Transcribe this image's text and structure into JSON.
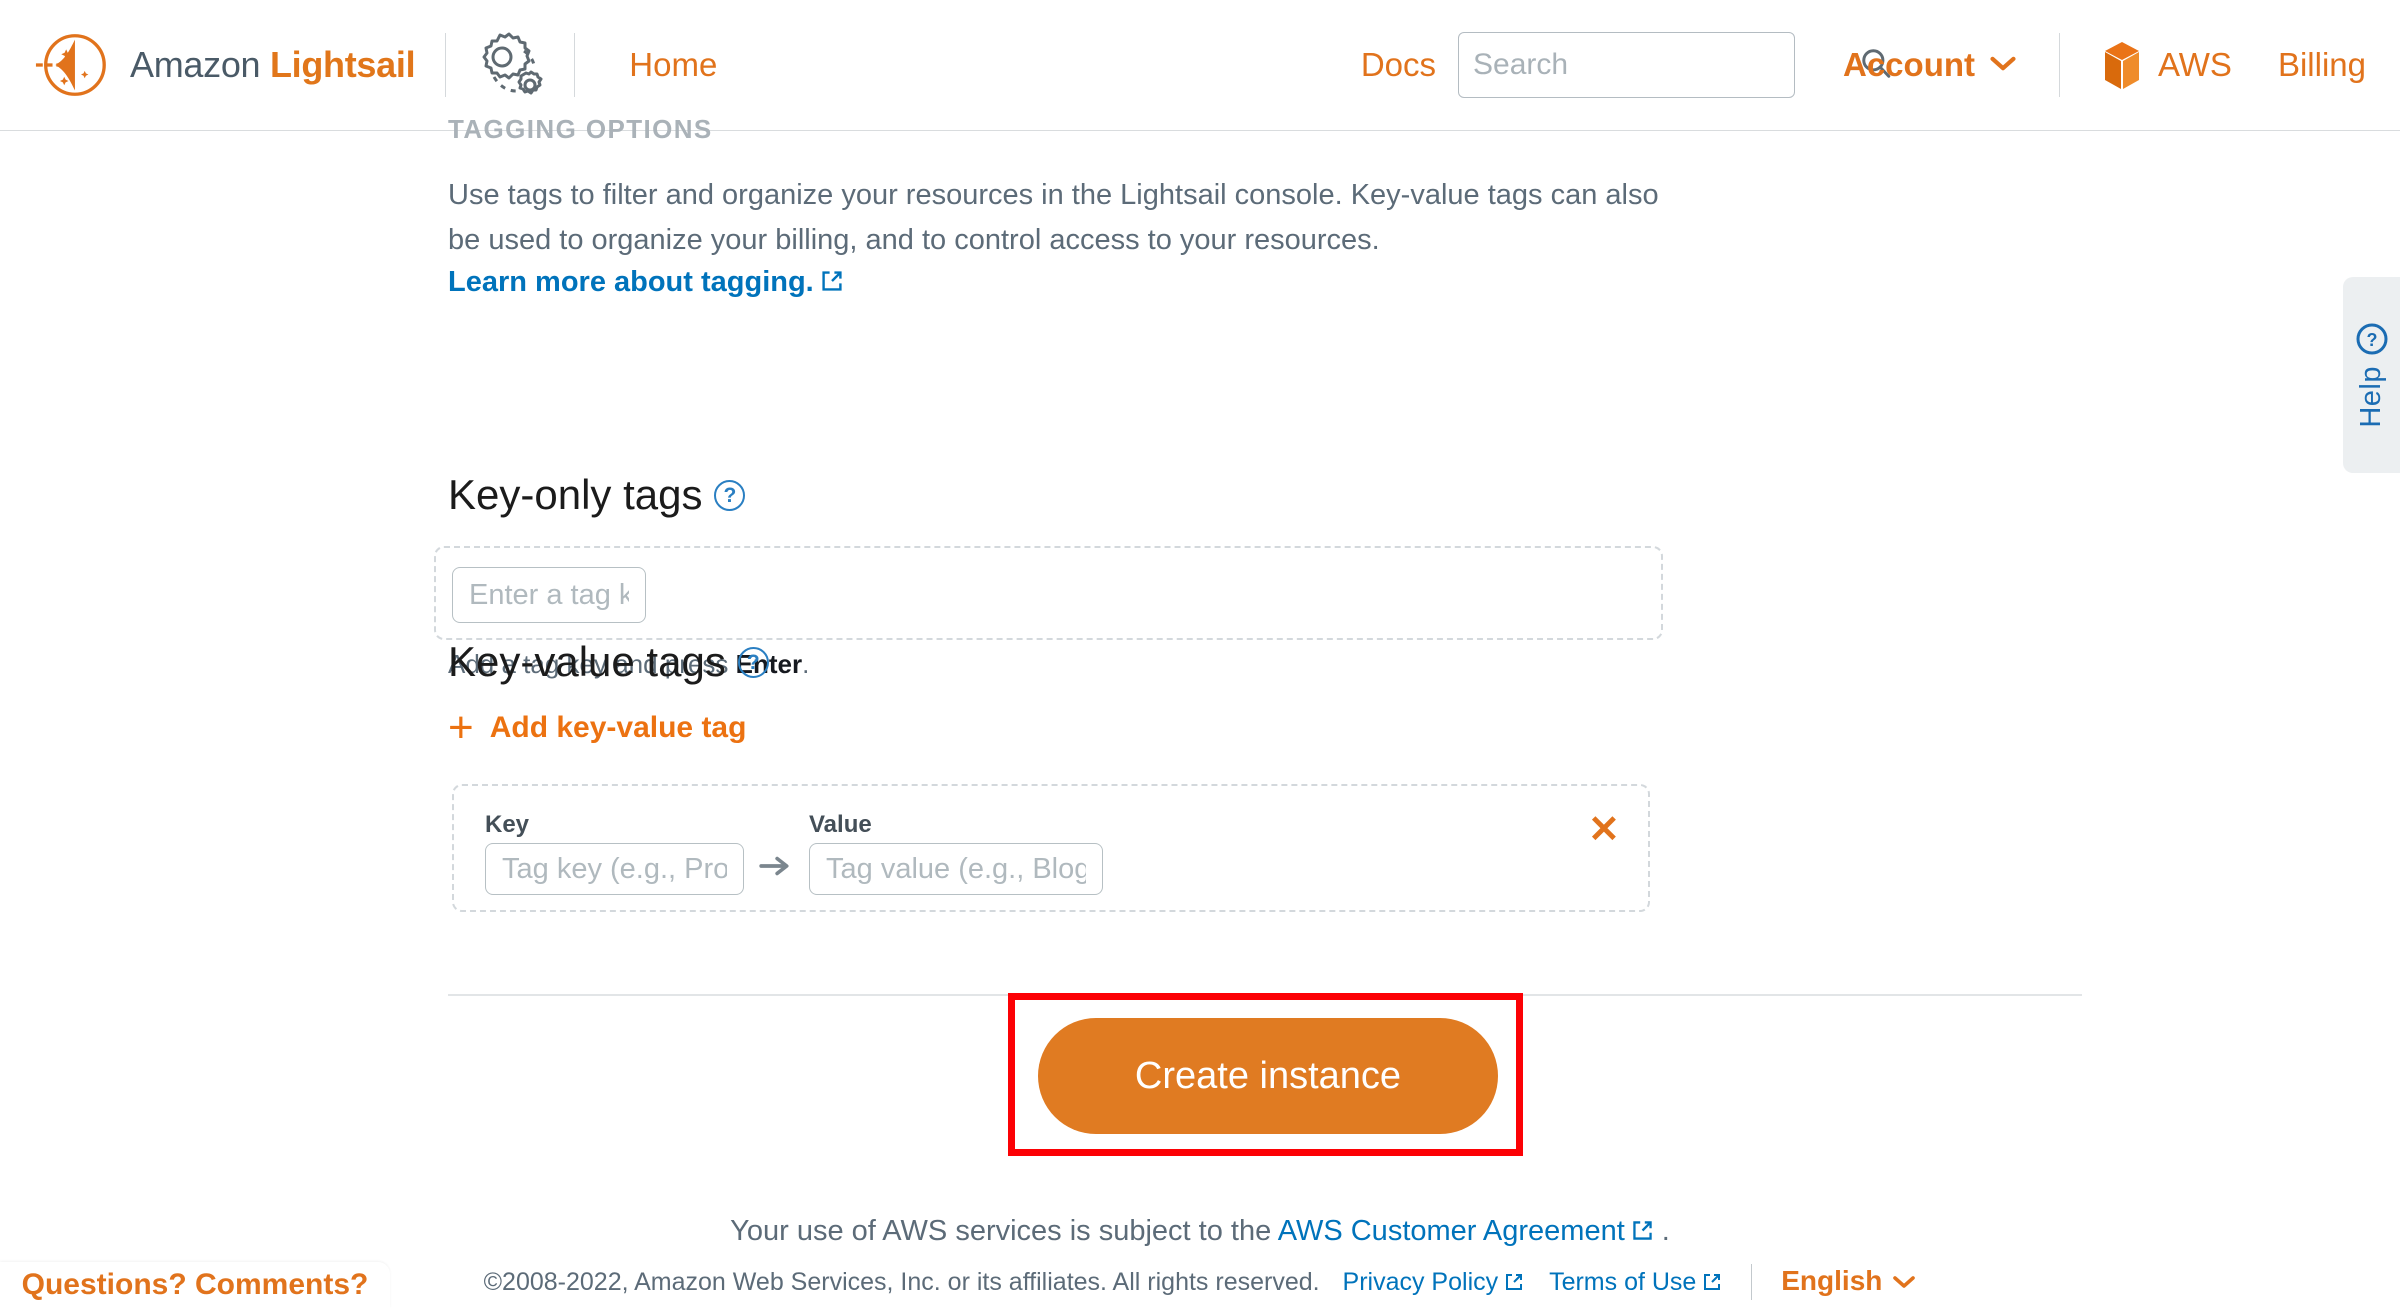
{
  "header": {
    "brand_primary": "Amazon ",
    "brand_secondary": "Lightsail",
    "logo_icon": "lightsail-logo-icon",
    "gear_icon": "gears-icon",
    "home_label": "Home",
    "docs_label": "Docs",
    "search": {
      "value": "",
      "placeholder": "Search",
      "icon": "search-icon"
    },
    "account_label": "Account",
    "account_caret_icon": "chevron-down-icon",
    "aws_label": "AWS",
    "aws_icon": "aws-cube-icon",
    "billing_label": "Billing"
  },
  "main": {
    "section_label": "TAGGING OPTIONS",
    "description_line1": "Use tags to filter and organize your resources in the Lightsail console. Key-value tags can also",
    "description_line2": "be used to organize your billing, and to control access to your resources.",
    "learn_more_label": "Learn more about tagging.",
    "external_link_icon": "external-link-icon",
    "key_only": {
      "title": "Key-only tags",
      "help_icon": "question-circle-icon",
      "input_value": "",
      "input_placeholder": "Enter a tag key",
      "hint_prefix": "Add a tag key and press ",
      "hint_key": "Enter",
      "hint_suffix": "."
    },
    "key_value": {
      "title": "Key-value tags",
      "help_icon": "question-circle-icon",
      "add_label": "Add key-value tag",
      "add_icon": "plus-icon",
      "key_label": "Key",
      "key_value": "",
      "key_placeholder": "Tag key (e.g., Project)",
      "arrow_icon": "arrow-right-icon",
      "value_label": "Value",
      "value_value": "",
      "value_placeholder": "Tag value (e.g., Blog)",
      "remove_icon": "close-x-icon"
    },
    "create_button_label": "Create instance"
  },
  "help_tab": {
    "label": "Help",
    "icon": "question-circle-icon"
  },
  "footer": {
    "line1_prefix": "Your use of AWS services is subject to the ",
    "agreement_label": "AWS Customer Agreement",
    "line1_suffix": ".",
    "copyright": "©2008-2022, Amazon Web Services, Inc. or its affiliates. All rights reserved.",
    "privacy_label": "Privacy Policy",
    "terms_label": "Terms of Use",
    "language_label": "English",
    "language_caret_icon": "chevron-down-icon",
    "questions_label": "Questions? Comments?"
  },
  "colors": {
    "brand_orange": "#e1731c",
    "button_orange": "#e07b22",
    "link_blue": "#0073bb",
    "highlight_red": "#fc0105",
    "text_gray": "#5c6b78"
  }
}
